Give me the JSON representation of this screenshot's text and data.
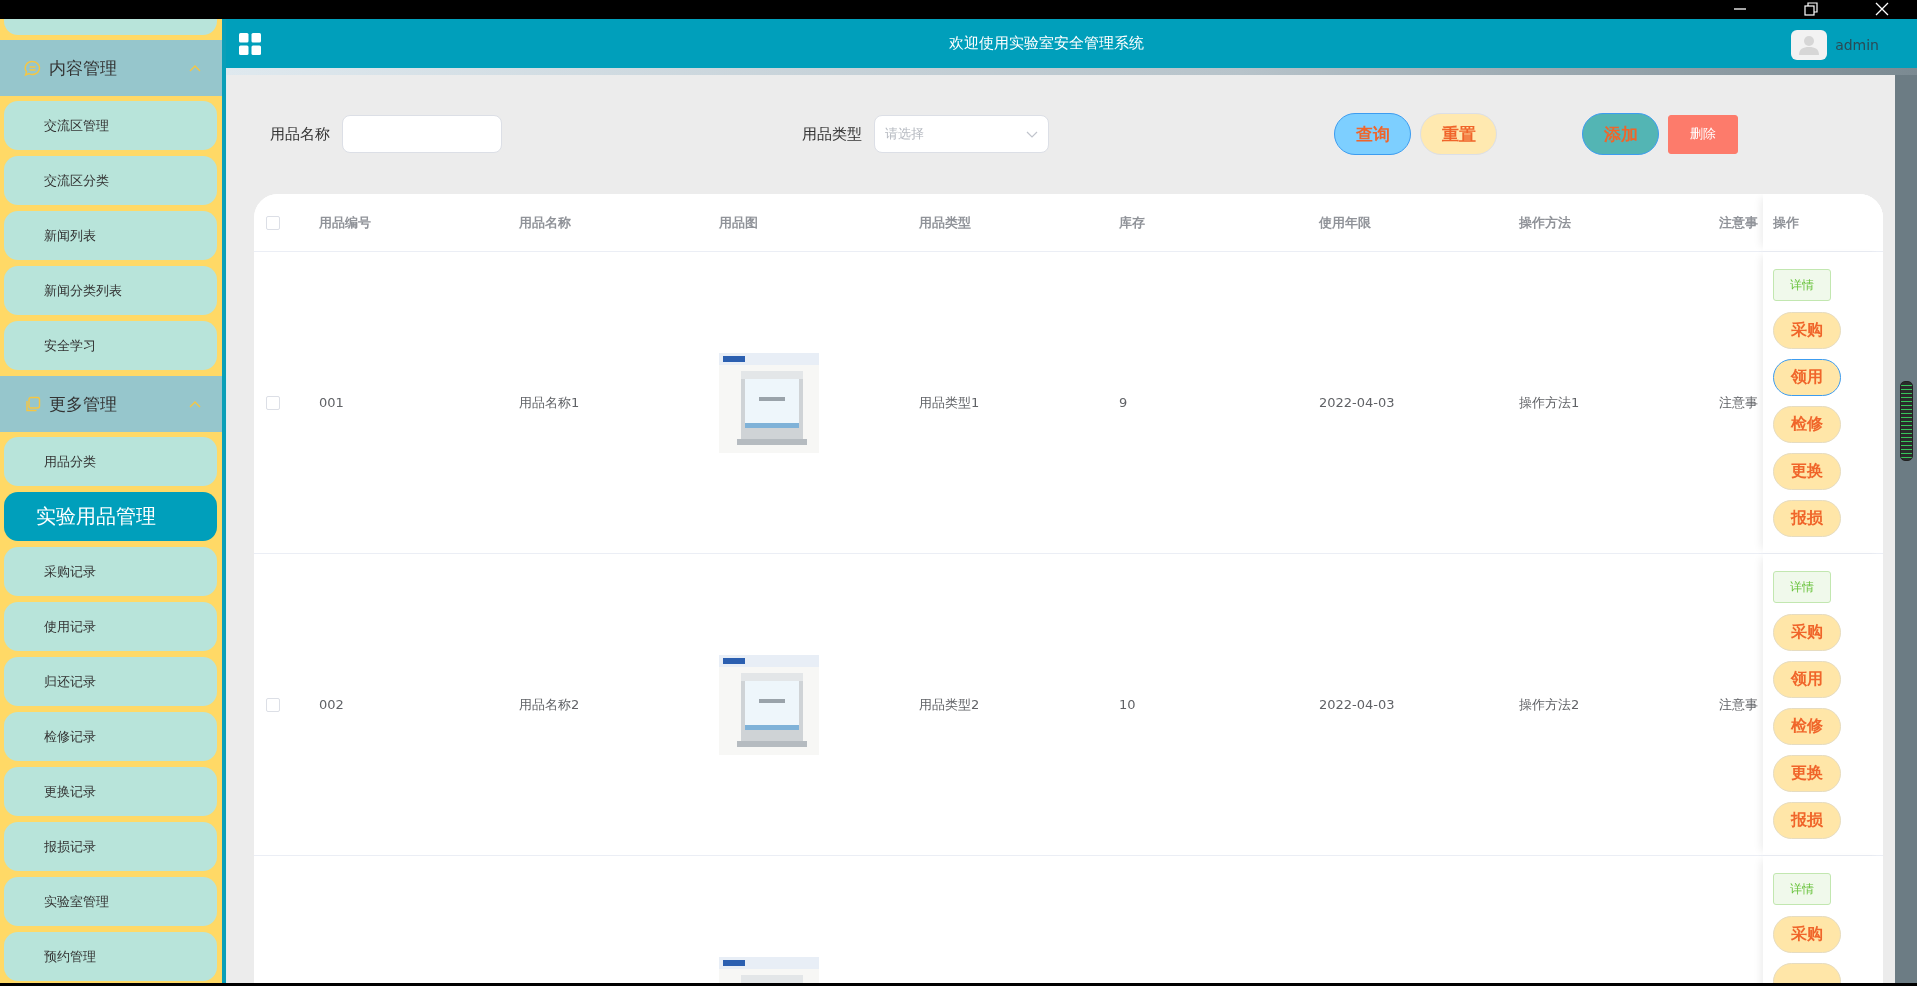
{
  "header": {
    "title": "欢迎使用实验室安全管理系统",
    "user": "admin"
  },
  "sidebar": {
    "groups": [
      {
        "title": "内容管理",
        "expanded": true,
        "items": [
          {
            "label": "交流区管理",
            "selected": false
          },
          {
            "label": "交流区分类",
            "selected": false
          },
          {
            "label": "新闻列表",
            "selected": false
          },
          {
            "label": "新闻分类列表",
            "selected": false
          },
          {
            "label": "安全学习",
            "selected": false
          }
        ]
      },
      {
        "title": "更多管理",
        "expanded": true,
        "items": [
          {
            "label": "用品分类",
            "selected": false
          },
          {
            "label": "实验用品管理",
            "selected": true
          },
          {
            "label": "采购记录",
            "selected": false
          },
          {
            "label": "使用记录",
            "selected": false
          },
          {
            "label": "归还记录",
            "selected": false
          },
          {
            "label": "检修记录",
            "selected": false
          },
          {
            "label": "更换记录",
            "selected": false
          },
          {
            "label": "报损记录",
            "selected": false
          },
          {
            "label": "实验室管理",
            "selected": false
          },
          {
            "label": "预约管理",
            "selected": false
          }
        ]
      }
    ]
  },
  "filters": [
    {
      "label": "用品名称",
      "kind": "text"
    },
    {
      "label": "用品类型",
      "kind": "select",
      "placeholder": "请选择"
    }
  ],
  "buttons": [
    {
      "label": "查询",
      "kind": "query"
    },
    {
      "label": "重置",
      "kind": "reset"
    },
    {
      "label": "添加",
      "kind": "add"
    },
    {
      "label": "删除",
      "kind": "delete"
    }
  ],
  "table": {
    "select_all": {
      "checked": false
    },
    "columns": [
      "用品编号",
      "用品名称",
      "用品图",
      "用品类型",
      "库存",
      "使用年限",
      "操作方法",
      "注意事",
      "操作"
    ],
    "rows": [
      {
        "checked": false,
        "cells": [
          "001",
          "用品名称1",
          {
            "kind": "picture"
          },
          "用品类型1",
          "9",
          "2022-04-03",
          "操作方法1",
          "注意事"
        ],
        "actions": [
          {
            "label": "详情",
            "kind": "detail",
            "focused": false
          },
          {
            "label": "采购",
            "kind": "action",
            "focused": false
          },
          {
            "label": "领用",
            "kind": "action",
            "focused": true
          },
          {
            "label": "检修",
            "kind": "action",
            "focused": false
          },
          {
            "label": "更换",
            "kind": "action",
            "focused": false
          },
          {
            "label": "报损",
            "kind": "action",
            "focused": false
          }
        ]
      },
      {
        "checked": false,
        "cells": [
          "002",
          "用品名称2",
          {
            "kind": "picture"
          },
          "用品类型2",
          "10",
          "2022-04-03",
          "操作方法2",
          "注意事"
        ],
        "actions": [
          {
            "label": "详情",
            "kind": "detail",
            "focused": false
          },
          {
            "label": "采购",
            "kind": "action",
            "focused": false
          },
          {
            "label": "领用",
            "kind": "action",
            "focused": false
          },
          {
            "label": "检修",
            "kind": "action",
            "focused": false
          },
          {
            "label": "更换",
            "kind": "action",
            "focused": false
          },
          {
            "label": "报损",
            "kind": "action",
            "focused": false
          }
        ]
      },
      {
        "cells": [
          null,
          null,
          {
            "kind": "picture"
          }
        ],
        "actions": [
          {
            "label": "详情",
            "kind": "detail",
            "focused": false
          },
          {
            "label": "采购",
            "kind": "action",
            "focused": false
          },
          {
            "kind": "action",
            "focused": false
          }
        ]
      }
    ]
  }
}
